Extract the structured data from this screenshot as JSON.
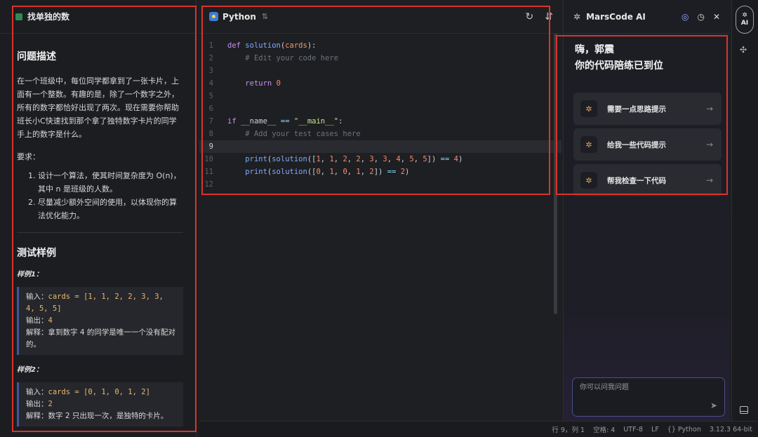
{
  "problem": {
    "title": "找单独的数",
    "desc_heading": "问题描述",
    "description": "在一个班级中，每位同学都拿到了一张卡片，上面有一个整数。有趣的是，除了一个数字之外，所有的数字都恰好出现了两次。现在需要你帮助班长小C快速找到那个拿了独特数字卡片的同学手上的数字是什么。",
    "requirements_label": "要求：",
    "requirements": [
      "设计一个算法，使其时间复杂度为 O(n)，其中 n 是班级的人数。",
      "尽量减少额外空间的使用，以体现你的算法优化能力。"
    ],
    "tests_heading": "测试样例",
    "samples": [
      {
        "label": "样例1：",
        "input_prefix": "输入：",
        "input": "cards = [1, 1, 2, 2, 3, 3, 4, 5, 5]",
        "output_prefix": "输出：",
        "output": "4",
        "explain_prefix": "解释：",
        "explain": "拿到数字 4 的同学是唯一一个没有配对的。"
      },
      {
        "label": "样例2：",
        "input_prefix": "输入：",
        "input": "cards = [0, 1, 0, 1, 2]",
        "output_prefix": "输出：",
        "output": "2",
        "explain_prefix": "解释：",
        "explain": "数字 2 只出现一次，是独特的卡片。"
      }
    ]
  },
  "editor": {
    "language": "Python",
    "switch_icon": "⇅",
    "refresh_icon": "refresh-icon",
    "format_icon": "format-icon",
    "active_line": 9,
    "lines": [
      "1",
      "2",
      "3",
      "4",
      "5",
      "6",
      "7",
      "8",
      "9",
      "10",
      "11",
      "12"
    ]
  },
  "ai": {
    "title": "MarsCode AI",
    "greeting_line1": "嗨，郭震",
    "greeting_line2": "你的代码陪练已到位",
    "suggestions": [
      "需要一点思路提示",
      "给我一些代码提示",
      "帮我检查一下代码"
    ],
    "input_placeholder": "你可以问我问题",
    "rail_label": "AI"
  },
  "status": {
    "position": "行 9，列 1",
    "spaces": "空格: 4",
    "encoding": "UTF-8",
    "eol": "LF",
    "language": "{} Python",
    "version": "3.12.3 64-bit"
  },
  "colors": {
    "accent": "#3d7bd9",
    "annotation": "#d9342b",
    "background": "#1e1f22"
  }
}
